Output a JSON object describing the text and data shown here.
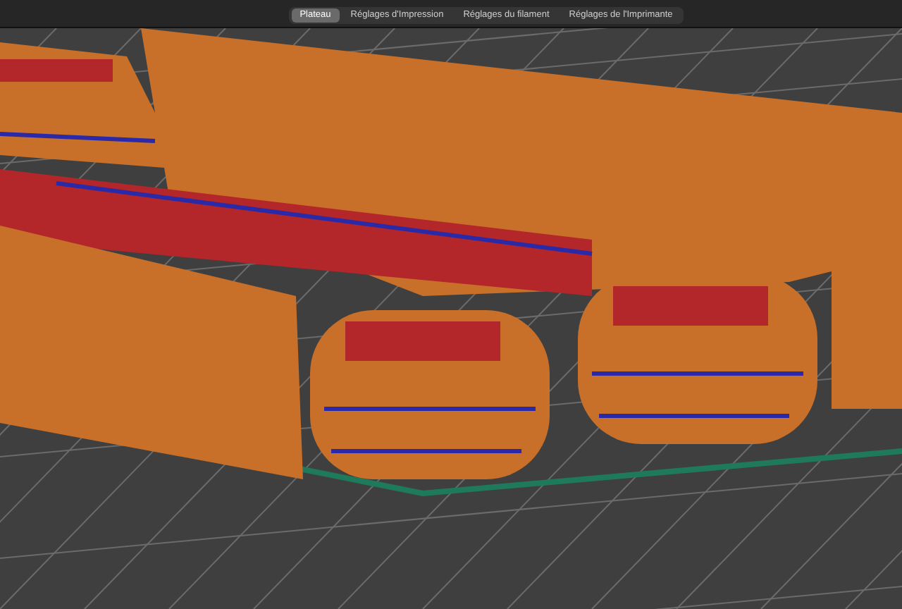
{
  "tabs": [
    {
      "label": "Plateau",
      "selected": true
    },
    {
      "label": "Réglages d'Impression",
      "selected": false
    },
    {
      "label": "Réglages du filament",
      "selected": false
    },
    {
      "label": "Réglages de l'Imprimante",
      "selected": false
    }
  ]
}
